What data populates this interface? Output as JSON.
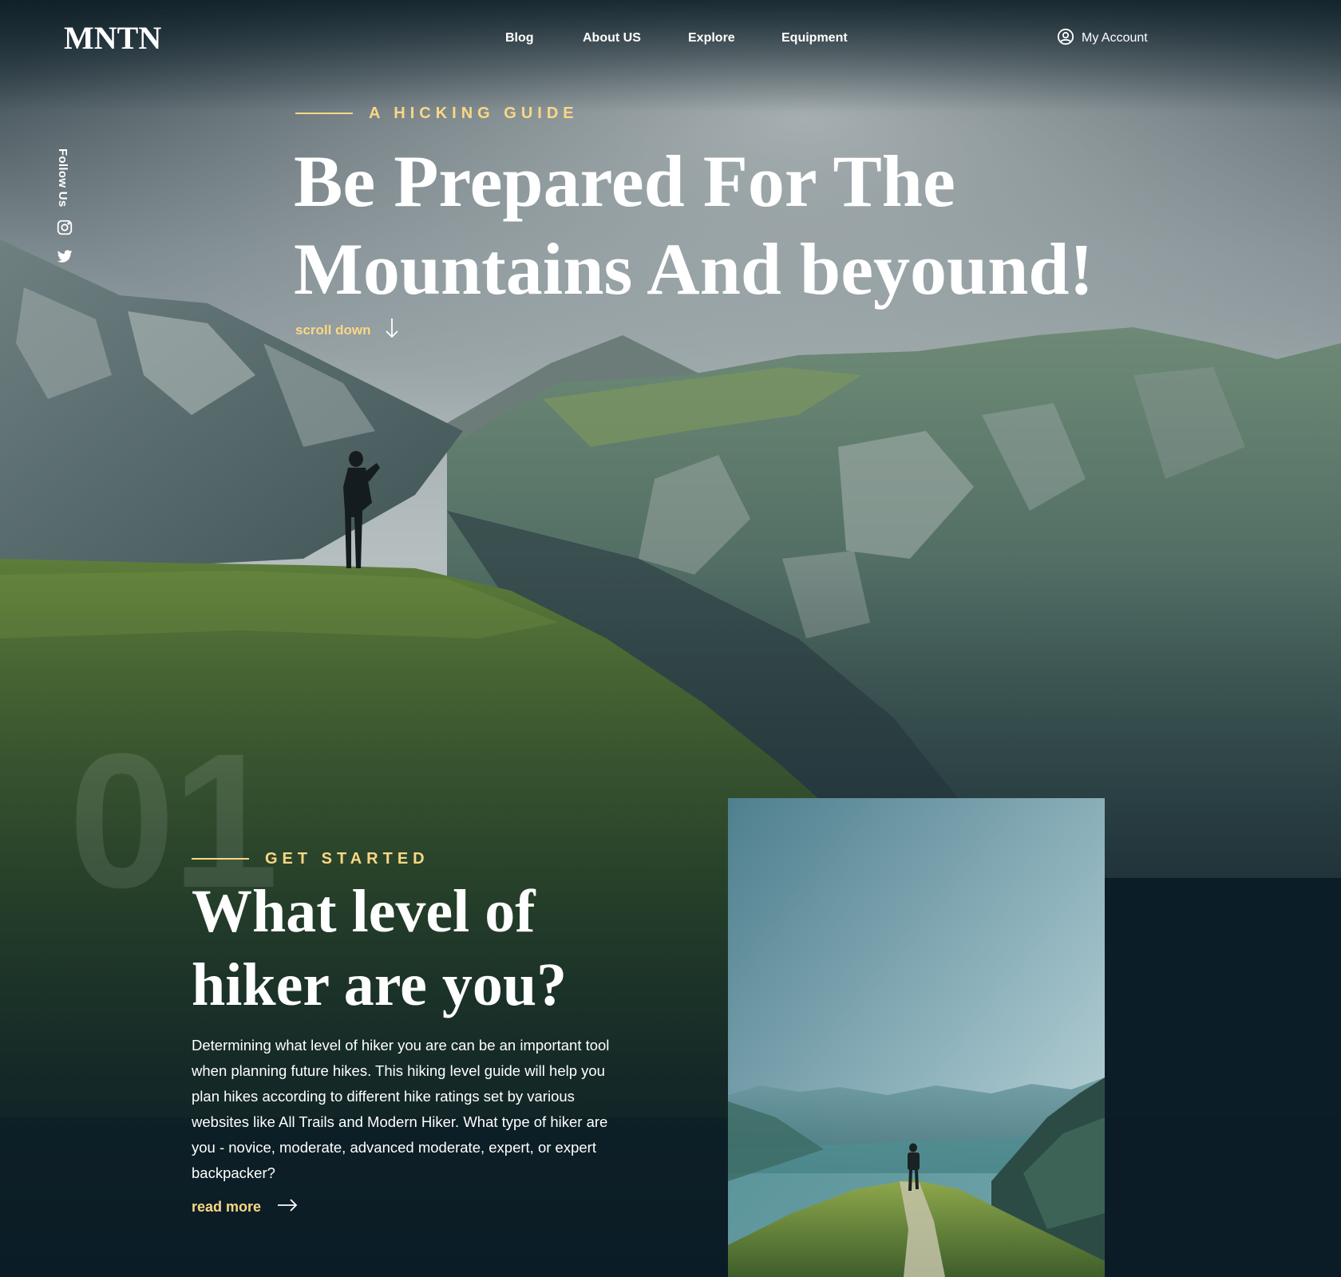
{
  "header": {
    "logo": "MNTN",
    "nav": [
      {
        "label": "Blog"
      },
      {
        "label": "About US"
      },
      {
        "label": "Explore"
      },
      {
        "label": "Equipment"
      }
    ],
    "account_label": "My Account",
    "account_icon": "user-circle-icon"
  },
  "social": {
    "label": "Follow Us",
    "icons": [
      "instagram-icon",
      "twitter-icon"
    ]
  },
  "hero": {
    "eyebrow": "A Hicking Guide",
    "title": "Be Prepared For The Mountains And beyound!",
    "scroll_label": "scroll down",
    "scroll_icon": "arrow-down-icon"
  },
  "section": {
    "number": "01",
    "eyebrow": "Get Started",
    "title": "What level of hiker are you?",
    "body": "Determining what level of hiker you are can be an important tool when planning future hikes. This hiking level guide will help you plan hikes according to different hike ratings set by various websites like All Trails and Modern Hiker. What type of hiker are you - novice, moderate, advanced moderate, expert, or expert backpacker?",
    "read_more_label": "read more",
    "read_more_icon": "arrow-right-icon"
  },
  "colors": {
    "accent": "#fbd784",
    "background": "#0b1d26",
    "text": "#ffffff"
  }
}
